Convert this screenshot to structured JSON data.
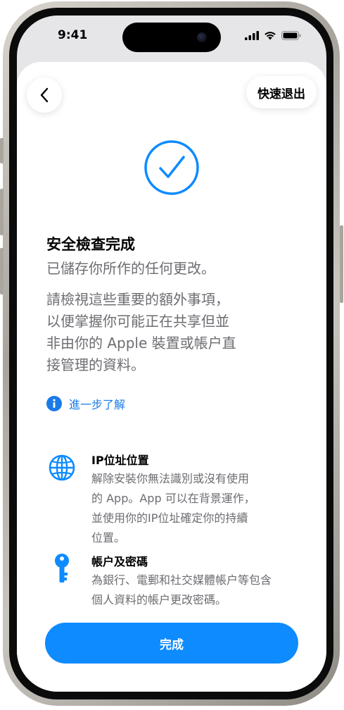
{
  "status_bar": {
    "time": "9:41"
  },
  "nav": {
    "quick_exit_label": "快速退出"
  },
  "main": {
    "title": "安全檢查完成",
    "subtitle": "已儲存你所作的任何更改。",
    "description_lines": [
      "請檢視這些重要的額外事項，",
      "以便掌握你可能正在共享但並",
      "非由你的 Apple 裝置或帳户直",
      "接管理的資料。"
    ],
    "learn_more": "進一步了解"
  },
  "items": [
    {
      "icon": "globe-icon",
      "title": "IP位址位置",
      "lines": [
        "解除安裝你無法識別或沒有使用",
        "的 App。App 可以在背景運作，",
        "並使用你的IP位址確定你的持續",
        "位置。"
      ]
    },
    {
      "icon": "key-icon",
      "title": "帳户及密碼",
      "lines": [
        "為銀行、電郵和社交媒體帳户等包含",
        "個人資料的帳户更改密碼。"
      ]
    }
  ],
  "footer": {
    "done_label": "完成"
  },
  "colors": {
    "accent": "#0d8bff",
    "link": "#1a7be8",
    "secondary_text": "#6d6d72"
  }
}
